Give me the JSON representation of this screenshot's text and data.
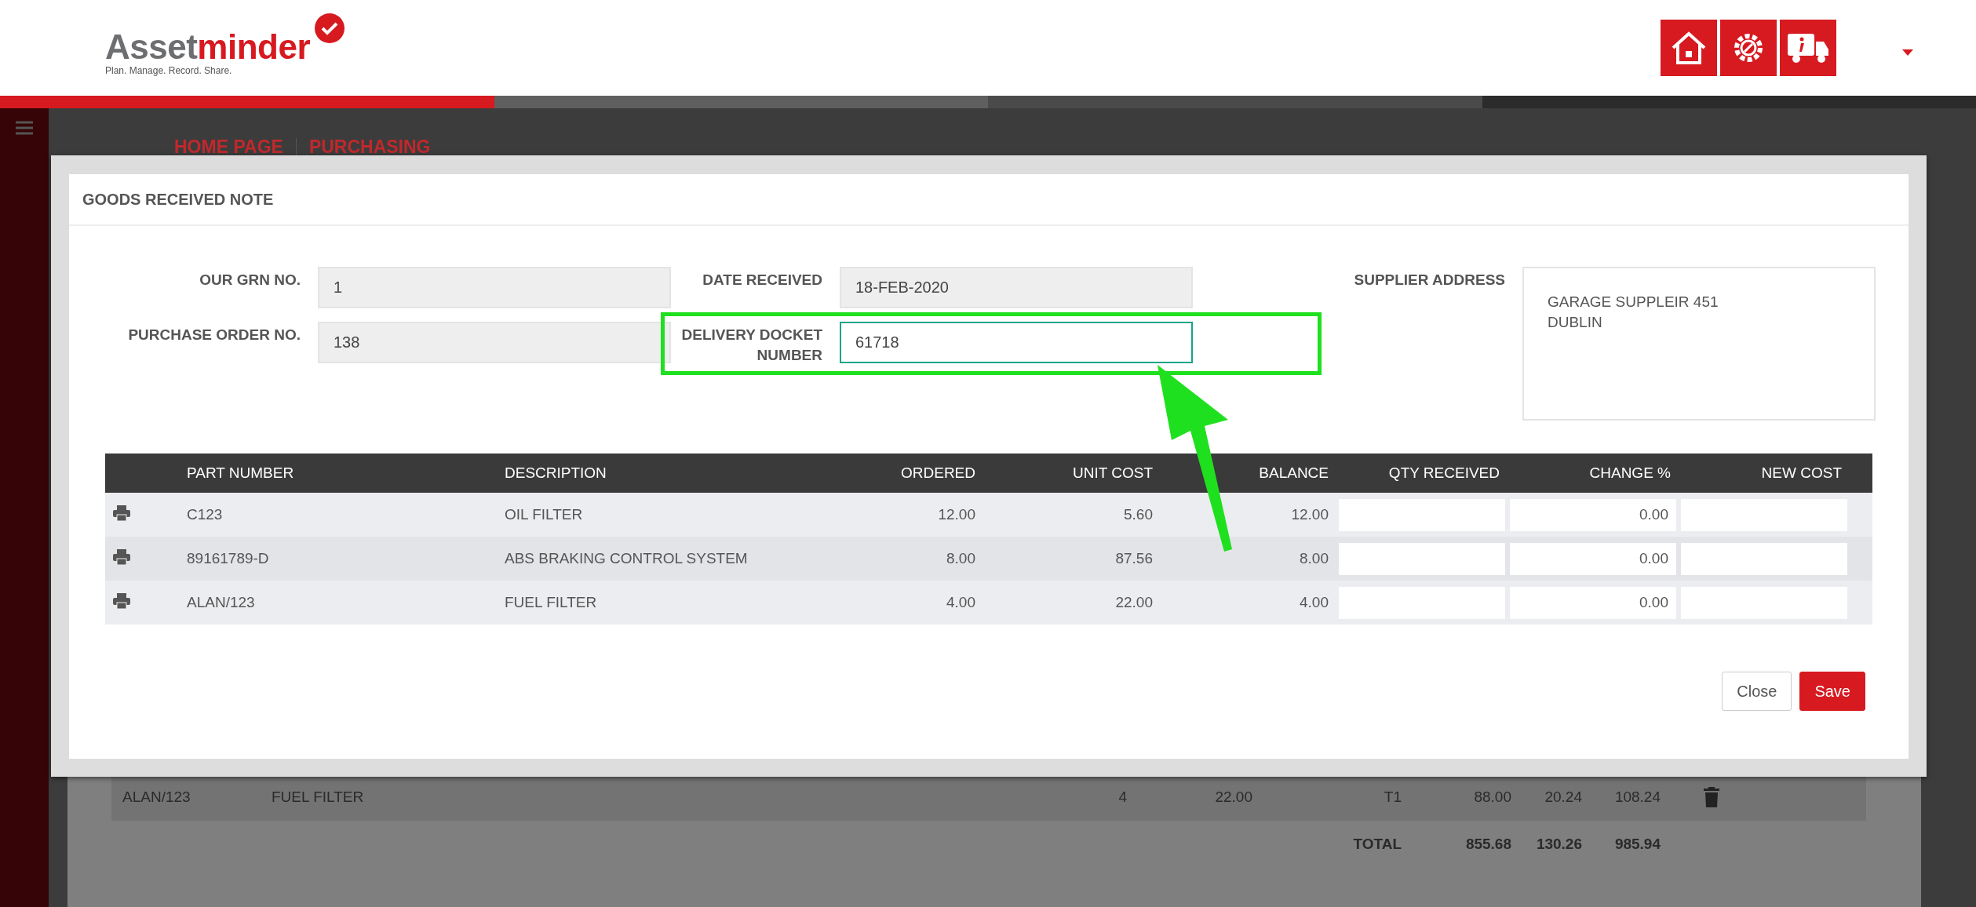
{
  "header": {
    "logo": {
      "first": "Asset",
      "second": "minder",
      "tagline": "Plan. Manage. Record. Share."
    },
    "icons": [
      {
        "kind": "home"
      },
      {
        "kind": "gear"
      },
      {
        "kind": "truck"
      }
    ]
  },
  "progress": [
    {
      "color": "#d71920"
    },
    {
      "color": "#5f5f5f"
    },
    {
      "color": "#4a4a4a"
    },
    {
      "color": "#2b2b2b"
    }
  ],
  "breadcrumb": [
    "HOME PAGE",
    "PURCHASING"
  ],
  "background_table": {
    "rows": [
      {
        "cells": [
          "ALAN/123",
          "FUEL FILTER",
          "4",
          "22.00",
          "T1",
          "88.00",
          "20.24",
          "108.24"
        ]
      }
    ],
    "total": {
      "label": "TOTAL",
      "values": [
        "855.68",
        "130.26",
        "985.94"
      ]
    }
  },
  "modal": {
    "title": "GOODS RECEIVED NOTE",
    "fields": [
      {
        "label": "OUR GRN NO.",
        "value": "1",
        "readonly": true,
        "highlighted": false
      },
      {
        "label": "PURCHASE ORDER NO.",
        "value": "138",
        "readonly": true,
        "highlighted": false
      },
      {
        "label": "DATE RECEIVED",
        "value": "18-FEB-2020",
        "readonly": true,
        "highlighted": false
      },
      {
        "label": "DELIVERY DOCKET NUMBER",
        "value": "61718",
        "readonly": false,
        "highlighted": true
      }
    ],
    "supplier": {
      "label": "SUPPLIER ADDRESS",
      "lines": [
        "GARAGE SUPPLEIR 451",
        "DUBLIN"
      ]
    },
    "table": {
      "columns": [
        "PART NUMBER",
        "DESCRIPTION",
        "ORDERED",
        "UNIT COST",
        "BALANCE",
        "QTY RECEIVED",
        "CHANGE %",
        "NEW COST"
      ],
      "rows": [
        {
          "part": "C123",
          "description": "OIL FILTER",
          "ordered": "12.00",
          "unit_cost": "5.60",
          "balance": "12.00",
          "change": "0.00"
        },
        {
          "part": "89161789-D",
          "description": "ABS BRAKING CONTROL SYSTEM",
          "ordered": "8.00",
          "unit_cost": "87.56",
          "balance": "8.00",
          "change": "0.00"
        },
        {
          "part": "ALAN/123",
          "description": "FUEL FILTER",
          "ordered": "4.00",
          "unit_cost": "22.00",
          "balance": "4.00",
          "change": "0.00"
        }
      ]
    },
    "buttons": [
      {
        "label": "Close",
        "kind": "secondary"
      },
      {
        "label": "Save",
        "kind": "primary"
      }
    ]
  }
}
